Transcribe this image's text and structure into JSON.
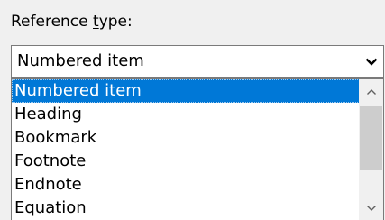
{
  "reference_type": {
    "label_before": "Reference ",
    "label_accel": "t",
    "label_after": "ype:",
    "selected_value": "Numbered item",
    "dropdown_icon": "chevron-down-icon"
  },
  "list": {
    "items": [
      {
        "label": "Numbered item",
        "selected": true
      },
      {
        "label": "Heading"
      },
      {
        "label": "Bookmark"
      },
      {
        "label": "Footnote"
      },
      {
        "label": "Endnote"
      },
      {
        "label": "Equation"
      }
    ],
    "scroll_up_icon": "chevron-up-icon",
    "scroll_down_icon": "chevron-down-icon"
  },
  "colors": {
    "selection": "#0078d7",
    "dialog_background": "#f0f0f0",
    "border": "#7a7a7a",
    "scroll_thumb": "#cdcdcd"
  }
}
